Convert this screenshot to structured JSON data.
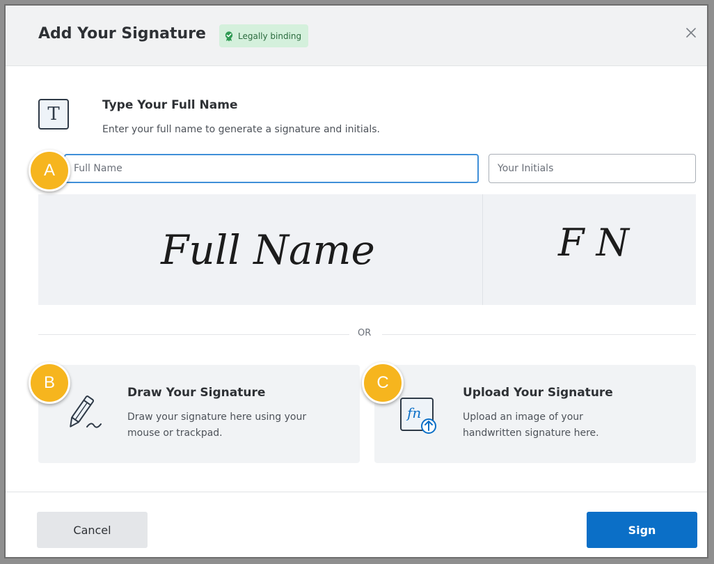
{
  "dialog": {
    "title": "Add Your Signature",
    "badge": "Legally binding",
    "close_icon": "close-icon"
  },
  "type_section": {
    "icon": "text-t-icon",
    "title": "Type Your Full Name",
    "description": "Enter your full name to generate a signature and initials.",
    "full_name_placeholder": "Full Name",
    "initials_placeholder": "Your Initials",
    "preview_signature": "Full Name",
    "preview_initials": "F N"
  },
  "divider_text": "OR",
  "draw_card": {
    "icon": "pen-icon",
    "title": "Draw Your Signature",
    "description": "Draw your signature here using your mouse or trackpad."
  },
  "upload_card": {
    "icon": "upload-signature-icon",
    "title": "Upload Your Signature",
    "description": "Upload an image of your handwritten signature here."
  },
  "markers": [
    "A",
    "B",
    "C"
  ],
  "footer": {
    "cancel_label": "Cancel",
    "sign_label": "Sign"
  },
  "colors": {
    "primary": "#0b6fc7",
    "badge_bg": "#d4f0dc",
    "marker": "#f6b51e",
    "focus_border": "#3f8fd8"
  }
}
